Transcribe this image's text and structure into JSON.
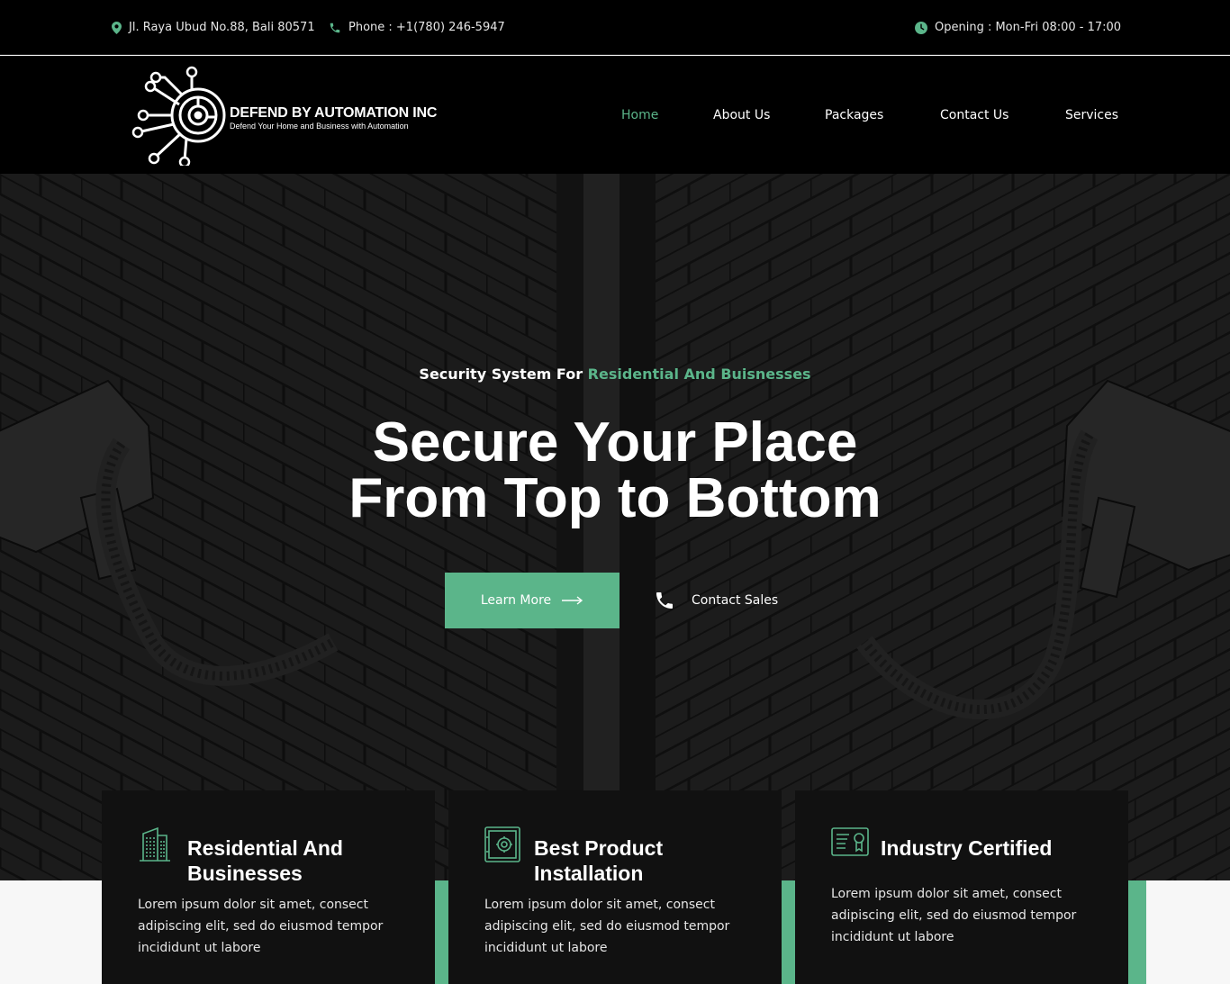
{
  "topbar": {
    "address": "Jl. Raya Ubud No.88, Bali 80571",
    "phone": "Phone : +1(780) 246-5947",
    "opening": "Opening : Mon-Fri 08:00 - 17:00"
  },
  "brand": {
    "name": "DEFEND BY AUTOMATION INC",
    "tagline": "Defend Your Home and Business with Automation"
  },
  "nav": {
    "items": [
      {
        "label": "Home",
        "active": true
      },
      {
        "label": "About Us"
      },
      {
        "label": "Packages"
      },
      {
        "label": "Contact Us"
      },
      {
        "label": "Services"
      }
    ]
  },
  "hero": {
    "kicker_prefix": "Security System For",
    "kicker_highlight": "Residential And Buisnesses",
    "title_line1": "Secure Your Place",
    "title_line2": "From Top to Bottom",
    "learn_more": "Learn More",
    "contact_sales": "Contact Sales"
  },
  "features": [
    {
      "icon": "building-icon",
      "title": "Residential And Businesses",
      "text": "Lorem ipsum dolor sit amet, consect adipiscing elit, sed do eiusmod tempor incididunt ut labore"
    },
    {
      "icon": "safe-icon",
      "title": "Best Product Installation",
      "text": "Lorem ipsum dolor sit amet, consect adipiscing elit, sed do eiusmod tempor incididunt ut labore"
    },
    {
      "icon": "certificate-icon",
      "title": "Industry Certified",
      "text": "Lorem ipsum dolor sit amet, consect adipiscing elit, sed do eiusmod tempor incididunt ut labore"
    }
  ],
  "colors": {
    "accent": "#5bb58a",
    "dark": "#000000",
    "card": "#111111"
  }
}
